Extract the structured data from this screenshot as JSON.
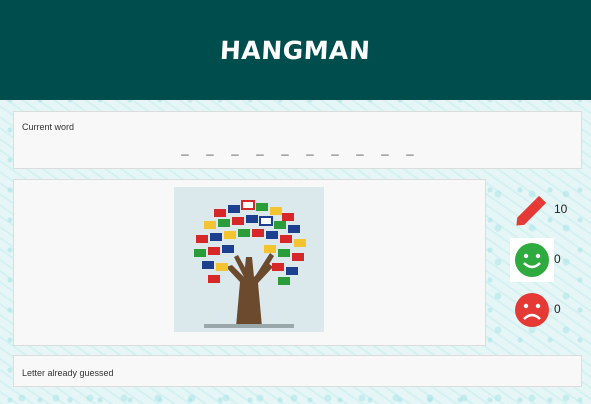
{
  "header": {
    "title": "HANGMAN"
  },
  "current_word": {
    "label": "Current word",
    "blanks": [
      "_",
      "_",
      "_",
      "_",
      "_",
      "_",
      "_",
      "_",
      "_",
      "_"
    ]
  },
  "image": {
    "alt": ""
  },
  "stats": {
    "attempts": "10",
    "correct": "0",
    "wrong": "0"
  },
  "icons": {
    "attempts": "pencil-icon",
    "correct": "smile-icon",
    "wrong": "sad-icon"
  },
  "colors": {
    "header_bg": "#004d4d",
    "pencil": "#e53935",
    "smile": "#2eaa3f",
    "sad": "#e53935"
  },
  "guessed": {
    "label": "Letter already guessed",
    "letters": ""
  }
}
